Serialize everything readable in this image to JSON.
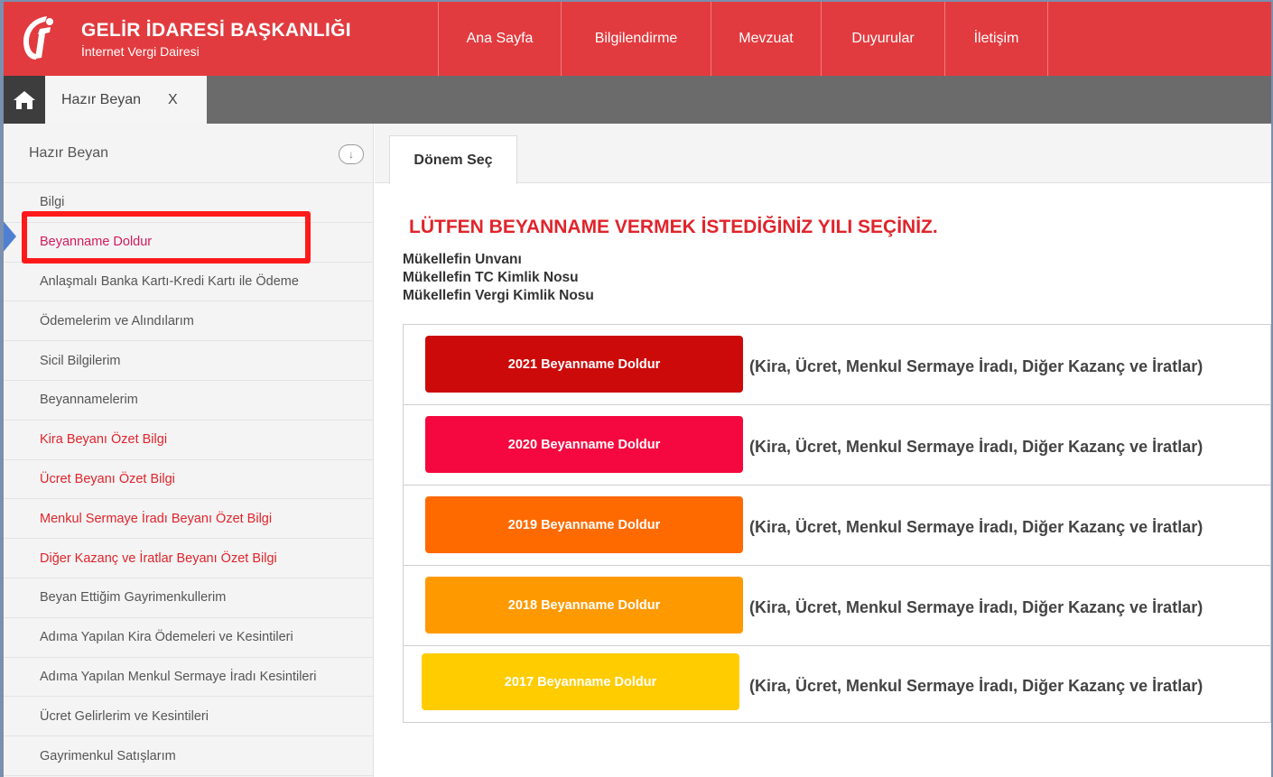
{
  "header": {
    "title": "GELİR İDARESİ BAŞKANLIĞI",
    "subtitle": "İnternet Vergi Dairesi",
    "logo_icon": "gib-logo-icon",
    "nav": [
      {
        "label": "Ana Sayfa"
      },
      {
        "label": "Bilgilendirme"
      },
      {
        "label": "Mevzuat"
      },
      {
        "label": "Duyurular"
      },
      {
        "label": "İletişim"
      }
    ]
  },
  "tabbar": {
    "home_icon": "home-icon",
    "open_tab_label": "Hazır Beyan",
    "close_label": "X"
  },
  "sidebar": {
    "title": "Hazır Beyan",
    "collapse_glyph": "↓",
    "items": [
      {
        "label": "Bilgi",
        "style": "normal"
      },
      {
        "label": "Beyanname Doldur",
        "style": "active"
      },
      {
        "label": "Anlaşmalı Banka Kartı-Kredi Kartı ile Ödeme",
        "style": "normal"
      },
      {
        "label": "Ödemelerim ve Alındılarım",
        "style": "normal"
      },
      {
        "label": "Sicil Bilgilerim",
        "style": "normal"
      },
      {
        "label": "Beyannamelerim",
        "style": "normal"
      },
      {
        "label": "Kira Beyanı Özet Bilgi",
        "style": "red"
      },
      {
        "label": "Ücret Beyanı Özet Bilgi",
        "style": "red"
      },
      {
        "label": "Menkul Sermaye İradı Beyanı Özet Bilgi",
        "style": "red"
      },
      {
        "label": "Diğer Kazanç ve İratlar Beyanı Özet Bilgi",
        "style": "red"
      },
      {
        "label": "Beyan Ettiğim Gayrimenkullerim",
        "style": "normal"
      },
      {
        "label": "Adıma Yapılan Kira Ödemeleri ve Kesintileri",
        "style": "normal"
      },
      {
        "label": "Adıma Yapılan Menkul Sermaye İradı Kesintileri",
        "style": "normal"
      },
      {
        "label": "Ücret Gelirlerim ve Kesintileri",
        "style": "normal"
      },
      {
        "label": "Gayrimenkul Satışlarım",
        "style": "normal"
      }
    ]
  },
  "main": {
    "tab_label": "Dönem Seç",
    "heading": "LÜTFEN BEYANNAME VERMEK İSTEDİĞİNİZ YILI SEÇİNİZ.",
    "info": [
      "Mükellefin Unvanı",
      "Mükellefin TC Kimlik Nosu",
      "Mükellefin Vergi Kimlik Nosu"
    ],
    "years": [
      {
        "button": "2021 Beyanname Doldur",
        "desc": "(Kira, Ücret, Menkul Sermaye İradı, Diğer Kazanç ve İratlar)",
        "color": "#cc0a0a"
      },
      {
        "button": "2020 Beyanname Doldur",
        "desc": "(Kira, Ücret, Menkul Sermaye İradı, Diğer Kazanç ve İratlar)",
        "color": "#f5083f"
      },
      {
        "button": "2019 Beyanname Doldur",
        "desc": "(Kira, Ücret, Menkul Sermaye İradı, Diğer Kazanç ve İratlar)",
        "color": "#ff6a00"
      },
      {
        "button": "2018 Beyanname Doldur",
        "desc": "(Kira, Ücret, Menkul Sermaye İradı, Diğer Kazanç ve İratlar)",
        "color": "#ff9900"
      },
      {
        "button": "2017 Beyanname Doldur",
        "desc": "(Kira, Ücret, Menkul Sermaye İradı, Diğer Kazanç ve İratlar)",
        "color": "#ffcc00"
      }
    ]
  },
  "colors": {
    "header_bg": "#e23b3f",
    "tabbar_bg": "#6b6b6b",
    "highlight": "#ff1a1a",
    "pointer": "#4f7fd0"
  }
}
